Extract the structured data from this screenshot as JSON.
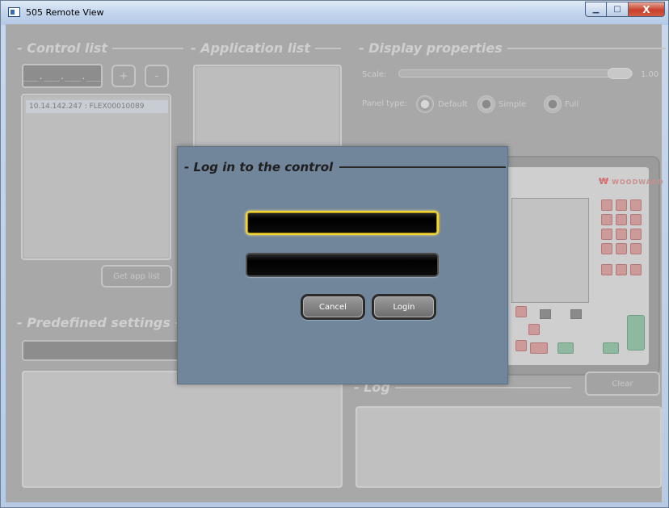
{
  "window": {
    "title": "505 Remote View",
    "minimize_glyph": "▁",
    "maximize_glyph": "□",
    "close_glyph": "X"
  },
  "control_list": {
    "title": "- Control list",
    "ip_value": "___.___.___.___",
    "add_label": "+",
    "remove_label": "-",
    "items": [
      "10.14.142.247 :    FLEX00010089"
    ],
    "get_app_list_label": "Get app list"
  },
  "application_list": {
    "title": "- Application list"
  },
  "display_properties": {
    "title": "- Display properties",
    "scale_label": "Scale:",
    "scale_value": "1.00",
    "panel_type_label": "Panel type:",
    "options": [
      "Default",
      "Simple",
      "Full"
    ],
    "selected_option": "Default"
  },
  "hardware_panel": {
    "brand": "WOODWARD"
  },
  "predefined_settings": {
    "title": "- Predefined settings"
  },
  "log": {
    "title": "- Log",
    "clear_label": "Clear"
  },
  "login_dialog": {
    "title": "- Log in to the control",
    "username_value": "",
    "password_value": "",
    "cancel_label": "Cancel",
    "login_label": "Login"
  },
  "colors": {
    "dialog_bg": "#71859b",
    "focus_border": "#f1d43a"
  }
}
